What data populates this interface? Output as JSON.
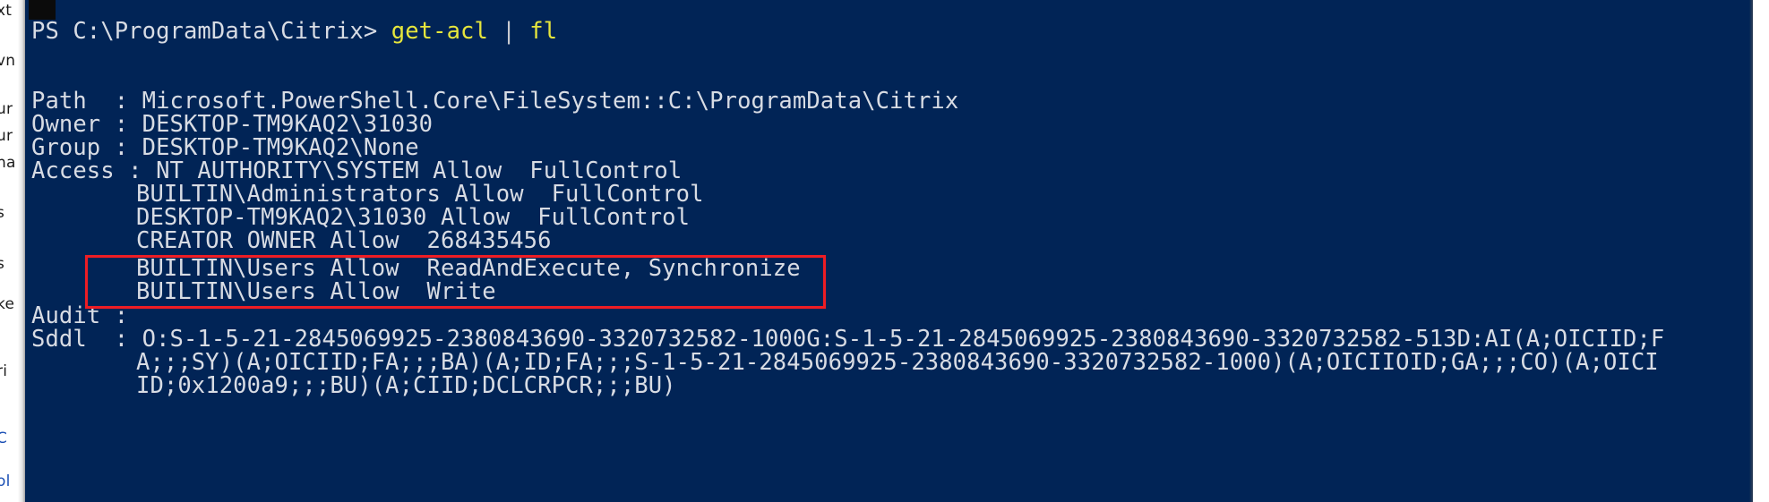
{
  "window": {
    "type": "powershell-console",
    "background_color": "#012456",
    "text_color": "#d8dce4",
    "accent_color": "#e6e63c"
  },
  "background_document": {
    "fragments": [
      "xt",
      "vn",
      "ur",
      "ur",
      "na",
      "s",
      "s",
      "ke",
      "ri",
      "C",
      "ol"
    ]
  },
  "console": {
    "prompt": {
      "path": "PS C:\\ProgramData\\Citrix>",
      "command": "get-acl",
      "pipe": "|",
      "formatter": "fl"
    },
    "output_lines": [
      {
        "key": "Path",
        "sep": ": ",
        "value": "Microsoft.PowerShell.Core\\FileSystem::C:\\ProgramData\\Citrix"
      },
      {
        "key": "Owner",
        "sep": ": ",
        "value": "DESKTOP-TM9KAQ2\\31030"
      },
      {
        "key": "Group",
        "sep": ": ",
        "value": "DESKTOP-TM9KAQ2\\None"
      },
      {
        "key": "Access",
        "sep": ": ",
        "value": "NT AUTHORITY\\SYSTEM Allow  FullControl"
      },
      {
        "key": "",
        "sep": "",
        "value": "BUILTIN\\Administrators Allow  FullControl"
      },
      {
        "key": "",
        "sep": "",
        "value": "DESKTOP-TM9KAQ2\\31030 Allow  FullControl"
      },
      {
        "key": "",
        "sep": "",
        "value": "CREATOR OWNER Allow  268435456"
      },
      {
        "key": "",
        "sep": "",
        "value": "BUILTIN\\Users Allow  ReadAndExecute, Synchronize"
      },
      {
        "key": "",
        "sep": "",
        "value": "BUILTIN\\Users Allow  Write"
      },
      {
        "key": "Audit",
        "sep": ":",
        "value": ""
      },
      {
        "key": "Sddl",
        "sep": ": ",
        "value": "O:S-1-5-21-2845069925-2380843690-3320732582-1000G:S-1-5-21-2845069925-2380843690-3320732582-513D:AI(A;OICIID;F"
      },
      {
        "key": "",
        "sep": "",
        "value": "A;;;SY)(A;OICIID;FA;;;BA)(A;ID;FA;;;S-1-5-21-2845069925-2380843690-3320732582-1000)(A;OICIIOID;GA;;;CO)(A;OICI"
      },
      {
        "key": "",
        "sep": "",
        "value": "ID;0x1200a9;;;BU)(A;CIID;DCLCRPCR;;;BU)"
      }
    ],
    "raw_lines": [
      "PS C:\\ProgramData\\Citrix> get-acl | fl",
      "",
      "",
      "Path   : Microsoft.PowerShell.Core\\FileSystem::C:\\ProgramData\\Citrix",
      "Owner  : DESKTOP-TM9KAQ2\\31030",
      "Group  : DESKTOP-TM9KAQ2\\None",
      "Access : NT AUTHORITY\\SYSTEM Allow  FullControl",
      "         BUILTIN\\Administrators Allow  FullControl",
      "         DESKTOP-TM9KAQ2\\31030 Allow  FullControl",
      "         CREATOR OWNER Allow  268435456",
      "         BUILTIN\\Users Allow  ReadAndExecute, Synchronize",
      "         BUILTIN\\Users Allow  Write",
      "Audit  :",
      "Sddl   : O:S-1-5-21-2845069925-2380843690-3320732582-1000G:S-1-5-21-2845069925-2380843690-3320732582-513D:AI(A;OICIID;F",
      "         A;;;SY)(A;OICIID;FA;;;BA)(A;ID;FA;;;S-1-5-21-2845069925-2380843690-3320732582-1000)(A;OICIIOID;GA;;;CO)(A;OICI",
      "         ID;0x1200a9;;;BU)(A;CIID;DCLCRPCR;;;BU)"
    ],
    "lines": {
      "prompt_path": "PS C:\\ProgramData\\Citrix>",
      "prompt_cmd": "get-acl",
      "prompt_pipe": "|",
      "prompt_fl": "fl",
      "path_key": "Path",
      "path_sep": "  : ",
      "path_val": "Microsoft.PowerShell.Core\\FileSystem::C:\\ProgramData\\Citrix",
      "owner_key": "Owner",
      "owner_sep": " : ",
      "owner_val": "DESKTOP-TM9KAQ2\\31030",
      "group_key": "Group",
      "group_sep": " : ",
      "group_val": "DESKTOP-TM9KAQ2\\None",
      "access_key": "Access",
      "access_sep": " : ",
      "access_val": "NT AUTHORITY\\SYSTEM Allow  FullControl",
      "access_2": "BUILTIN\\Administrators Allow  FullControl",
      "access_3": "DESKTOP-TM9KAQ2\\31030 Allow  FullControl",
      "access_4": "CREATOR OWNER Allow  268435456",
      "access_5": "BUILTIN\\Users Allow  ReadAndExecute, Synchronize",
      "access_6": "BUILTIN\\Users Allow  Write",
      "audit_key": "Audit",
      "audit_sep": " :",
      "sddl_key": "Sddl",
      "sddl_sep": "  : ",
      "sddl_1": "O:S-1-5-21-2845069925-2380843690-3320732582-1000G:S-1-5-21-2845069925-2380843690-3320732582-513D:AI(A;OICIID;F",
      "sddl_2": "A;;;SY)(A;OICIID;FA;;;BA)(A;ID;FA;;;S-1-5-21-2845069925-2380843690-3320732582-1000)(A;OICIIOID;GA;;;CO)(A;OICI",
      "sddl_3": "ID;0x1200a9;;;BU)(A;CIID;DCLCRPCR;;;BU)"
    }
  },
  "annotation": {
    "type": "rectangle-highlight",
    "color": "#ee1d24",
    "targets": [
      "BUILTIN\\Users Allow  ReadAndExecute, Synchronize",
      "BUILTIN\\Users Allow  Write"
    ]
  }
}
